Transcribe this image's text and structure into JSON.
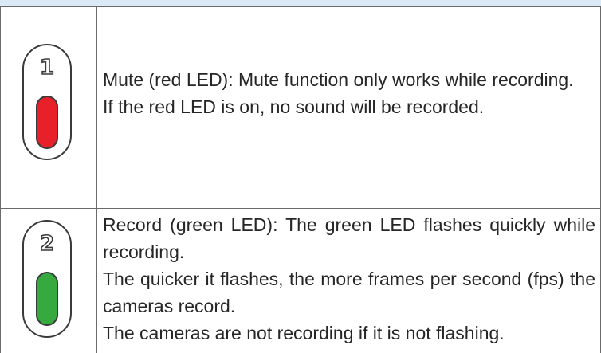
{
  "rows": [
    {
      "number": "1",
      "led_color": "#e8202a",
      "lines": [
        "Mute (red LED): Mute function only works while recording.",
        "If the red LED is on, no sound will be recorded."
      ]
    },
    {
      "number": "2",
      "led_color": "#36a93f",
      "lines": [
        "Record (green LED): The green LED flashes quickly while recording.",
        "The quicker it flashes, the more frames per second (fps) the cameras record.",
        "The cameras are not recording if it is not flashing."
      ]
    }
  ]
}
